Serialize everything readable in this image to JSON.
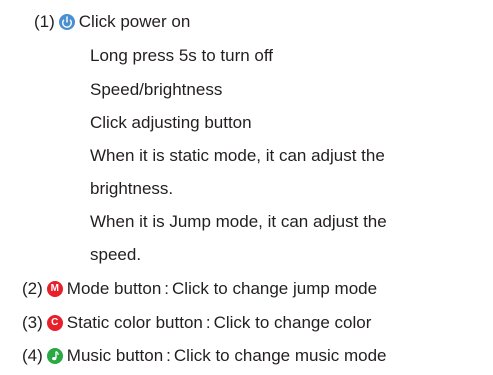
{
  "colors": {
    "power_icon": "#4a8fcf",
    "mode_icon": "#e8202a",
    "static_icon": "#e8202a",
    "music_icon": "#2aa844",
    "text": "#231f20"
  },
  "items": [
    {
      "number": "(1)",
      "icon": "power-icon",
      "lines": [
        "Click power on",
        "Long press 5s to turn off",
        "Speed/brightness",
        "Click adjusting button",
        "When it is static mode, it can adjust the",
        "brightness.",
        "When it is Jump mode, it can adjust the",
        "speed."
      ]
    },
    {
      "number": "(2)",
      "icon": "mode-icon",
      "icon_letter": "M",
      "label": "Mode button",
      "separator": ":",
      "desc": "Click to change jump mode"
    },
    {
      "number": "(3)",
      "icon": "static-color-icon",
      "icon_letter": "C",
      "label": "Static color button",
      "separator": ":",
      "desc": "Click to change color"
    },
    {
      "number": "(4)",
      "icon": "music-icon",
      "label": "Music button",
      "separator": ":",
      "desc": "Click to change music mode"
    }
  ]
}
